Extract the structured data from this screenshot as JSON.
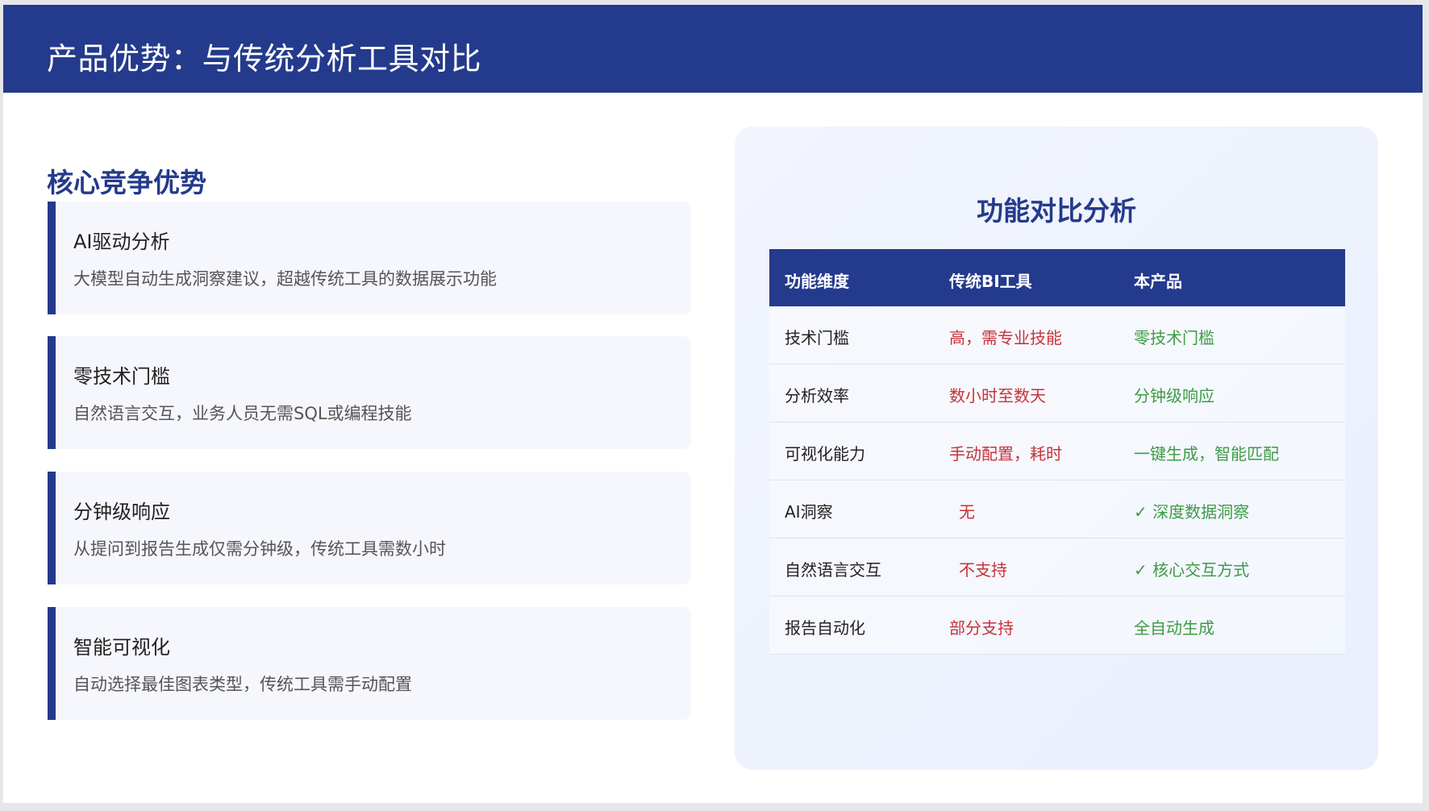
{
  "header": {
    "title": "产品优势：与传统分析工具对比"
  },
  "left": {
    "section_title": "核心竞争优势",
    "cards": [
      {
        "title": "AI驱动分析",
        "desc": "大模型自动生成洞察建议，超越传统工具的数据展示功能"
      },
      {
        "title": "零技术门槛",
        "desc": "自然语言交互，业务人员无需SQL或编程技能"
      },
      {
        "title": "分钟级响应",
        "desc": "从提问到报告生成仅需分钟级，传统工具需数小时"
      },
      {
        "title": "智能可视化",
        "desc": "自动选择最佳图表类型，传统工具需手动配置"
      }
    ]
  },
  "right": {
    "panel_title": "功能对比分析",
    "table": {
      "headers": [
        "功能维度",
        "传统BI工具",
        "本产品"
      ],
      "rows": [
        [
          "技术门槛",
          "高，需专业技能",
          "零技术门槛"
        ],
        [
          "分析效率",
          "数小时至数天",
          "分钟级响应"
        ],
        [
          "可视化能力",
          "手动配置，耗时",
          "一键生成，智能匹配"
        ],
        [
          "AI洞察",
          "无",
          "✓ 深度数据洞察"
        ],
        [
          "自然语言交互",
          "不支持",
          "✓ 核心交互方式"
        ],
        [
          "报告自动化",
          "部分支持",
          "全自动生成"
        ]
      ]
    }
  },
  "colors": {
    "brand": "#243a8c",
    "negative": "#c8323a",
    "positive": "#3f9a47"
  }
}
